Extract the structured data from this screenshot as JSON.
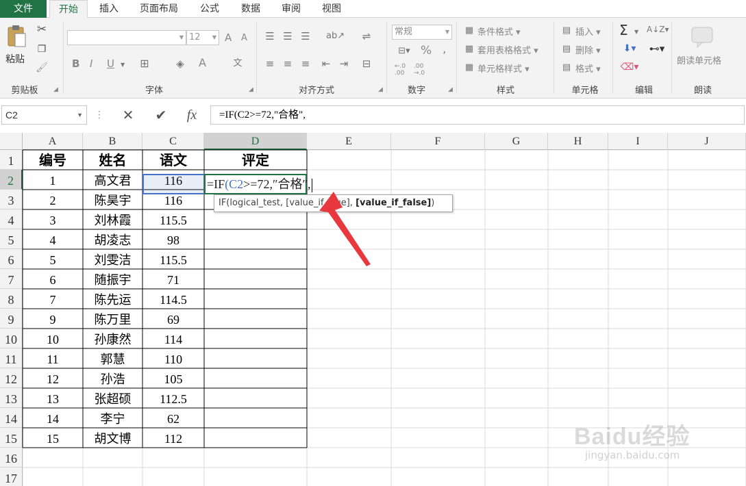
{
  "tabs": [
    "文件",
    "开始",
    "插入",
    "页面布局",
    "公式",
    "数据",
    "审阅",
    "视图"
  ],
  "ribbon": {
    "clipboard": {
      "paste": "粘贴",
      "label": "剪贴板"
    },
    "font": {
      "size": "12",
      "bold": "B",
      "italic": "I",
      "underline": "U",
      "grow": "A",
      "shrink": "A",
      "color_letter": "A",
      "label": "字体"
    },
    "alignment": {
      "label": "对齐方式"
    },
    "number": {
      "format": "常规",
      "percent": "%",
      "comma": ",",
      "inc_decimal": "←.0 .00",
      "dec_decimal": ".00 →.0",
      "label": "数字"
    },
    "styles": {
      "conditional": "条件格式",
      "table": "套用表格格式",
      "cell": "单元格样式",
      "label": "样式"
    },
    "cells": {
      "insert": "插入",
      "delete": "删除",
      "format": "格式",
      "label": "单元格"
    },
    "editing": {
      "sum": "Σ",
      "label": "编辑"
    },
    "read": {
      "button": "朗读单元格",
      "label": "朗读"
    }
  },
  "formula_bar": {
    "name_box": "C2",
    "fx": "fx",
    "content": "=IF(C2>=72,\"合格\","
  },
  "columns": [
    "A",
    "B",
    "C",
    "D",
    "E",
    "F",
    "G",
    "H",
    "I",
    "J"
  ],
  "rows": [
    "1",
    "2",
    "3",
    "4",
    "5",
    "6",
    "7",
    "8",
    "9",
    "10",
    "11",
    "12",
    "13",
    "14",
    "15",
    "16",
    "17"
  ],
  "table": {
    "headers": [
      "编号",
      "姓名",
      "语文",
      "评定"
    ],
    "records": [
      [
        "1",
        "高文君",
        "116"
      ],
      [
        "2",
        "陈昊宇",
        "116"
      ],
      [
        "3",
        "刘林霞",
        "115.5"
      ],
      [
        "4",
        "胡凌志",
        "98"
      ],
      [
        "5",
        "刘雯洁",
        "115.5"
      ],
      [
        "6",
        "随振宇",
        "71"
      ],
      [
        "7",
        "陈先运",
        "114.5"
      ],
      [
        "9",
        "陈万里",
        "69"
      ],
      [
        "10",
        "孙康然",
        "114"
      ],
      [
        "11",
        "郭慧",
        "110"
      ],
      [
        "12",
        "孙浩",
        "105"
      ],
      [
        "13",
        "张超硕",
        "112.5"
      ],
      [
        "14",
        "李宁",
        "62"
      ],
      [
        "15",
        "胡文博",
        "112"
      ]
    ]
  },
  "editing_cell": {
    "prefix": "=IF",
    "paren": "(",
    "ref": "C2",
    "rest": ">=72,″合格″,",
    "ref_color": "#4472c4"
  },
  "tooltip": {
    "text": "IF(logical_test, [value_if_true], ",
    "bold": "[value_if_false]",
    "close": ")"
  },
  "watermark": {
    "brand": "Baidu经验",
    "url": "jingyan.baidu.com"
  },
  "colors": {
    "excel_green": "#217346",
    "arrow_red": "#e8383d",
    "selection_blue": "#4472c4"
  }
}
